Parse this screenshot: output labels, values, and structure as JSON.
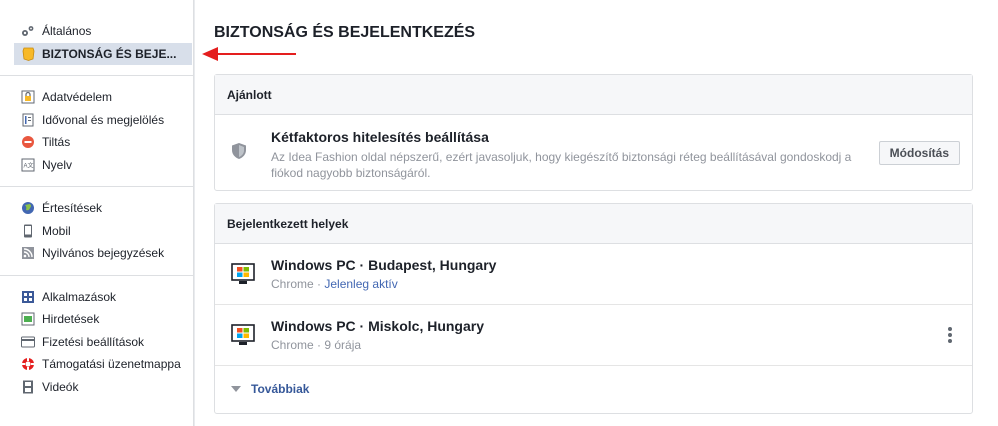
{
  "sidebar": {
    "groups": [
      {
        "items": [
          {
            "label": "Általános",
            "icon": "gears-icon"
          },
          {
            "label": "BIZTONSÁG ÉS BEJE...",
            "icon": "shield-badge-icon",
            "active": true
          }
        ]
      },
      {
        "items": [
          {
            "label": "Adatvédelem",
            "icon": "privacy-lock-icon"
          },
          {
            "label": "Idővonal és megjelölés",
            "icon": "timeline-icon"
          },
          {
            "label": "Tiltás",
            "icon": "block-icon"
          },
          {
            "label": "Nyelv",
            "icon": "language-icon"
          }
        ]
      },
      {
        "items": [
          {
            "label": "Értesítések",
            "icon": "globe-icon"
          },
          {
            "label": "Mobil",
            "icon": "mobile-icon"
          },
          {
            "label": "Nyilvános bejegyzések",
            "icon": "rss-icon"
          }
        ]
      },
      {
        "items": [
          {
            "label": "Alkalmazások",
            "icon": "apps-icon"
          },
          {
            "label": "Hirdetések",
            "icon": "ads-icon"
          },
          {
            "label": "Fizetési beállítások",
            "icon": "credit-card-icon"
          },
          {
            "label": "Támogatási üzenetmappa",
            "icon": "lifebuoy-icon"
          },
          {
            "label": "Videók",
            "icon": "film-icon"
          }
        ]
      }
    ]
  },
  "page": {
    "title": "BIZTONSÁG ÉS BEJELENTKEZÉS"
  },
  "recommended": {
    "header": "Ajánlott",
    "title": "Kétfaktoros hitelesítés beállítása",
    "description": "Az Idea Fashion oldal népszerű, ezért javasoljuk, hogy kiegészítő biztonsági réteg beállításával gondoskodj a fiókod nagyobb biztonságáról.",
    "button": "Módosítás"
  },
  "sessions": {
    "header": "Bejelentkezett helyek",
    "items": [
      {
        "title": "Windows PC · Budapest, Hungary",
        "browser": "Chrome",
        "separator": " · ",
        "status": "Jelenleg aktív",
        "active": true
      },
      {
        "title": "Windows PC · Miskolc, Hungary",
        "browser": "Chrome",
        "separator": " · ",
        "status": "9 órája",
        "active": false
      }
    ],
    "see_more": "Továbbiak"
  },
  "colors": {
    "accent": "#4267b2",
    "arrow": "#e41e1e",
    "active_bg": "#d8dfea"
  }
}
